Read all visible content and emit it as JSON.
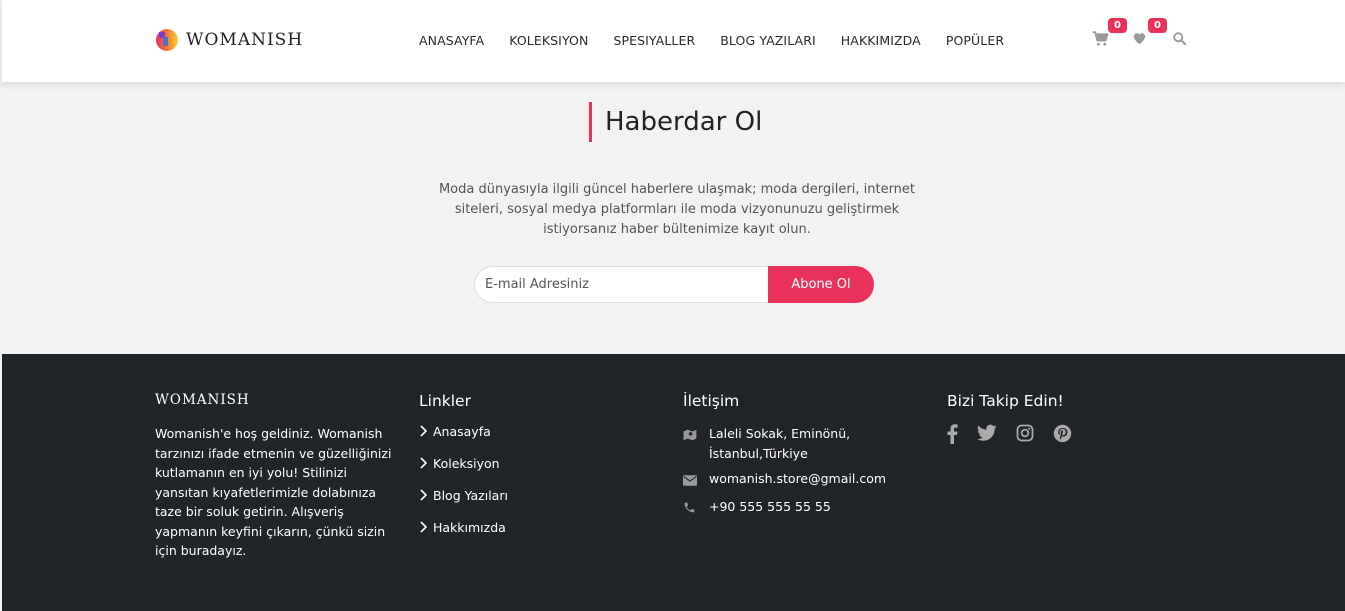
{
  "brand": {
    "name": "WOMANISH"
  },
  "nav": {
    "items": [
      "ANASAYFA",
      "KOLEKSIYON",
      "SPESIYALLER",
      "BLOG YAZILARI",
      "HAKKIMIZDA",
      "POPÜLER"
    ]
  },
  "header_icons": {
    "cart_count": "0",
    "wishlist_count": "0"
  },
  "newsletter": {
    "title": "Haberdar Ol",
    "text": "Moda dünyasıyla ilgili güncel haberlere ulaşmak; moda dergileri, internet siteleri, sosyal medya platformları ile moda vizyonunuzu geliştirmek istiyorsanız haber bültenimize kayıt olun.",
    "email_placeholder": "E-mail Adresiniz",
    "subscribe_label": "Abone Ol"
  },
  "footer": {
    "about": {
      "title": "WOMANISH",
      "text": "Womanish'e hoş geldiniz. Womanish tarzınızı ifade etmenin ve güzelliğinizi kutlamanın en iyi yolu! Stilinizi yansıtan kıyafetlerimizle dolabınıza taze bir soluk getirin. Alışveriş yapmanın keyfini çıkarın, çünkü sizin için buradayız."
    },
    "links": {
      "title": "Linkler",
      "items": [
        "Anasayfa",
        "Koleksiyon",
        "Blog Yazıları",
        "Hakkımızda"
      ]
    },
    "contact": {
      "title": "İletişim",
      "address": "Laleli Sokak, Eminönü, İstanbul,Türkiye",
      "email": "womanish.store@gmail.com",
      "phone": "+90 555 555 55 55"
    },
    "social": {
      "title": "Bizi Takip Edin!",
      "icons": [
        "facebook-icon",
        "twitter-icon",
        "instagram-icon",
        "pinterest-icon"
      ]
    }
  },
  "colors": {
    "accent": "#e8325c",
    "footer_bg": "#212529",
    "page_bg": "#f2f2f2"
  }
}
